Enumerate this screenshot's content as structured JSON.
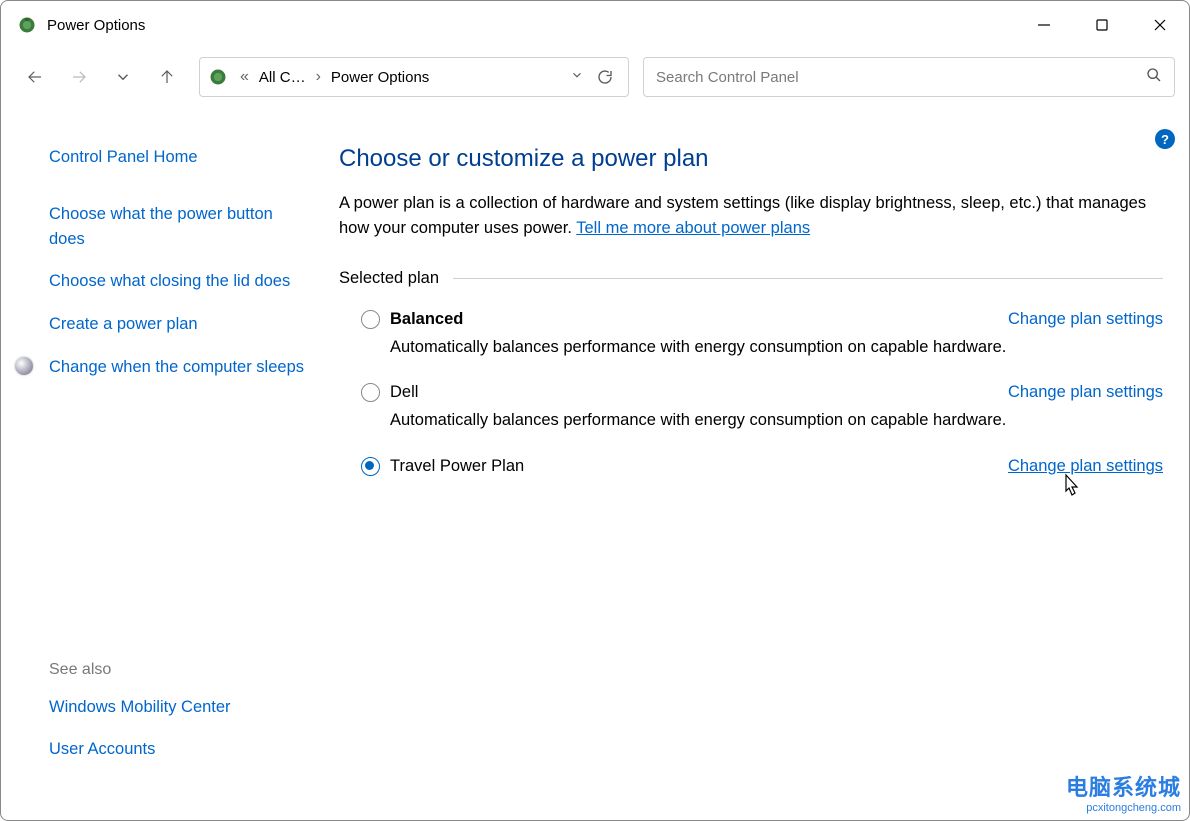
{
  "window": {
    "title": "Power Options"
  },
  "breadcrumb": {
    "prev_short": "«",
    "parent": "All C…",
    "current": "Power Options"
  },
  "search": {
    "placeholder": "Search Control Panel"
  },
  "sidebar": {
    "home": "Control Panel Home",
    "links": [
      "Choose what the power button does",
      "Choose what closing the lid does",
      "Create a power plan",
      "Change when the computer sleeps"
    ],
    "current_index": 3,
    "see_also_title": "See also",
    "see_also": [
      "Windows Mobility Center",
      "User Accounts"
    ]
  },
  "main": {
    "heading": "Choose or customize a power plan",
    "description": "A power plan is a collection of hardware and system settings (like display brightness, sleep, etc.) that manages how your computer uses power. ",
    "description_link": "Tell me more about power plans",
    "section_label": "Selected plan",
    "change_link_label": "Change plan settings",
    "plans": [
      {
        "name": "Balanced",
        "bold": true,
        "desc": "Automatically balances performance with energy consumption on capable hardware.",
        "selected": false
      },
      {
        "name": "Dell",
        "bold": false,
        "desc": "Automatically balances performance with energy consumption on capable hardware.",
        "selected": false
      },
      {
        "name": "Travel Power Plan",
        "bold": false,
        "desc": "",
        "selected": true
      }
    ]
  },
  "watermark": {
    "line1": "电脑系统城",
    "line2": "pcxitongcheng.com"
  }
}
